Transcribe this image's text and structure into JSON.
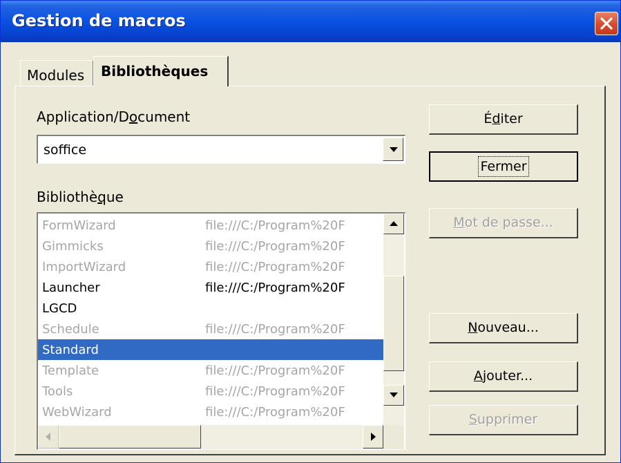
{
  "window": {
    "title": "Gestion de macros",
    "close_icon": "close-icon"
  },
  "tabs": [
    {
      "label": "Modules",
      "active": false
    },
    {
      "label": "Bibliothèques",
      "active": true
    }
  ],
  "application": {
    "label_pre": "Application/D",
    "label_mn": "o",
    "label_post": "cument",
    "value": "soffice"
  },
  "library": {
    "label_pre": "Bibliothè",
    "label_mn": "q",
    "label_post": "ue",
    "rows": [
      {
        "name": "FormWizard",
        "path": "file:///C:/Program%20F",
        "state": "disabled"
      },
      {
        "name": "Gimmicks",
        "path": "file:///C:/Program%20F",
        "state": "disabled"
      },
      {
        "name": "ImportWizard",
        "path": "file:///C:/Program%20F",
        "state": "disabled"
      },
      {
        "name": "Launcher",
        "path": "file:///C:/Program%20F",
        "state": "normal"
      },
      {
        "name": "LGCD",
        "path": "",
        "state": "normal"
      },
      {
        "name": "Schedule",
        "path": "file:///C:/Program%20F",
        "state": "disabled"
      },
      {
        "name": "Standard",
        "path": "",
        "state": "selected"
      },
      {
        "name": "Template",
        "path": "file:///C:/Program%20F",
        "state": "disabled"
      },
      {
        "name": "Tools",
        "path": "file:///C:/Program%20F",
        "state": "disabled"
      },
      {
        "name": "WebWizard",
        "path": "file:///C:/Program%20F",
        "state": "disabled"
      }
    ]
  },
  "buttons": {
    "edit": {
      "pre": "É",
      "mn": "d",
      "post": "iter"
    },
    "close": {
      "label": "Fermer"
    },
    "password": {
      "pre": "",
      "mn": "M",
      "post": "ot de passe..."
    },
    "new": {
      "pre": "",
      "mn": "N",
      "post": "ouveau..."
    },
    "add": {
      "pre": "",
      "mn": "A",
      "post": "jouter..."
    },
    "delete": {
      "pre": "",
      "mn": "S",
      "post": "upprimer"
    }
  },
  "colors": {
    "selection": "#316ac5",
    "titlebar": "#0a54e3",
    "disabled_text": "#a6a6a6"
  }
}
